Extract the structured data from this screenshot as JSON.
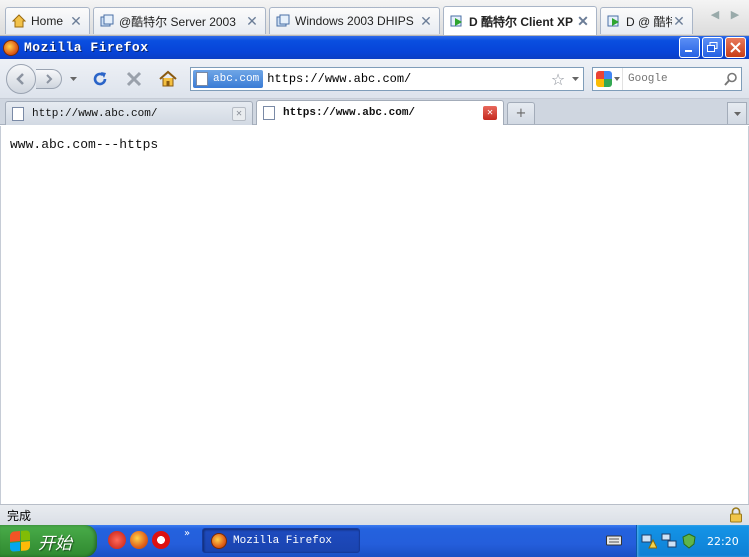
{
  "host_tabs": [
    {
      "label": "Home"
    },
    {
      "label": "@酷特尔 Server 2003"
    },
    {
      "label": "Windows 2003 DHIPS"
    },
    {
      "label": "D 酷特尔 Client XP"
    },
    {
      "label": "D @ 酷特"
    }
  ],
  "window": {
    "title": "Mozilla Firefox"
  },
  "navbar": {
    "identity_label": "abc.com",
    "url": "https://www.abc.com/",
    "search_placeholder": "Google"
  },
  "tabs": [
    {
      "label": "http://www.abc.com/"
    },
    {
      "label": "https://www.abc.com/"
    }
  ],
  "content": {
    "body_text": "www.abc.com---https"
  },
  "status": {
    "text": "完成"
  },
  "taskbar": {
    "start_label": "开始",
    "task_label": "Mozilla Firefox",
    "clock": "22:20"
  },
  "colors": {
    "titlebar": "#0744d8",
    "taskbar": "#245edb",
    "start": "#3c9a3c",
    "tray": "#1495e8"
  }
}
